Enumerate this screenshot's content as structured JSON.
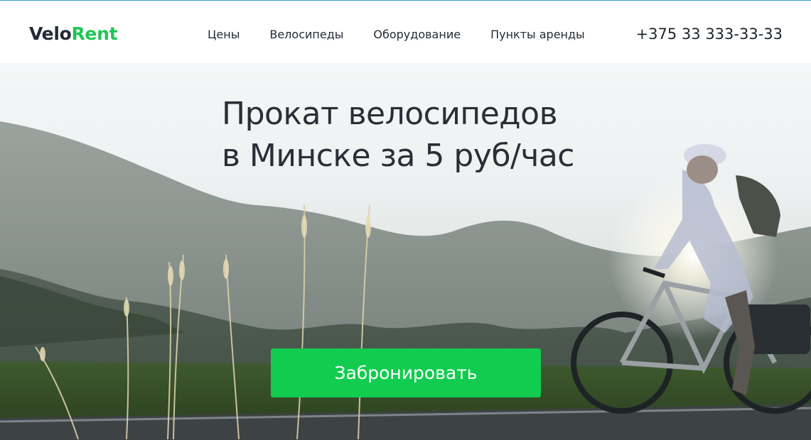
{
  "header": {
    "logo": {
      "part1": "Velo",
      "part2": "Rent",
      "color_dark": "#222a35",
      "color_accent": "#20c653"
    },
    "nav": [
      {
        "label": "Цены"
      },
      {
        "label": "Велосипеды"
      },
      {
        "label": "Оборудование"
      },
      {
        "label": "Пункты аренды"
      }
    ],
    "phone": "+375 33 333-33-33"
  },
  "hero": {
    "headline_line1": "Прокат велосипедов",
    "headline_line2": "в Минске за 5 руб/час",
    "cta_label": "Забронировать",
    "cta_color": "#12cc4f",
    "background_image": "cyclist-on-mountain-road-at-sunset"
  }
}
